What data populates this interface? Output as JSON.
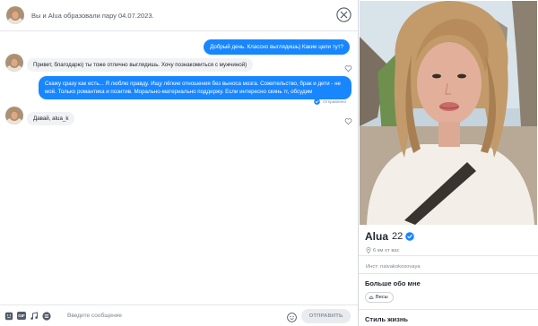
{
  "header": {
    "match_prefix": "Вы и",
    "match_name": "Alua",
    "match_suffix": "образовали пару 04.07.2023."
  },
  "messages": [
    {
      "direction": "outgoing",
      "text": "Добрый день. Классно выглядишь) Какие цели тут?"
    },
    {
      "direction": "incoming",
      "text": "Привет, благодарю) ты тоже отлично выглядишь. Хочу познакомиться с мужчиной)"
    },
    {
      "direction": "outgoing",
      "text": "Скажу сразу как есть... Я люблю правду. Ищу лёгкие отношения без выноса мозга. Сожительство, брак и дети - не моё. Только романтика и позитив. Морально-материально поддержу. Если интересно скинь тг, обсудим"
    },
    {
      "direction": "incoming",
      "text": "Давай, alua_k"
    }
  ],
  "sent_status": "Отправлено",
  "composer": {
    "gif_label": "GIF",
    "placeholder": "Введите сообщение",
    "value": "",
    "send_label": "ОТПРАВИТЬ"
  },
  "profile": {
    "name": "Alua",
    "age": "22",
    "distance": "6 км от вас",
    "instagram": "Инст: naivakokosovaya",
    "more_about_title": "Больше обо мне",
    "zodiac": "Весы",
    "lifestyle_title": "Стиль жизнь"
  },
  "colors": {
    "accent": "#1786ff",
    "bubble_in": "#f0f2f4",
    "verified": "#1786ff"
  }
}
